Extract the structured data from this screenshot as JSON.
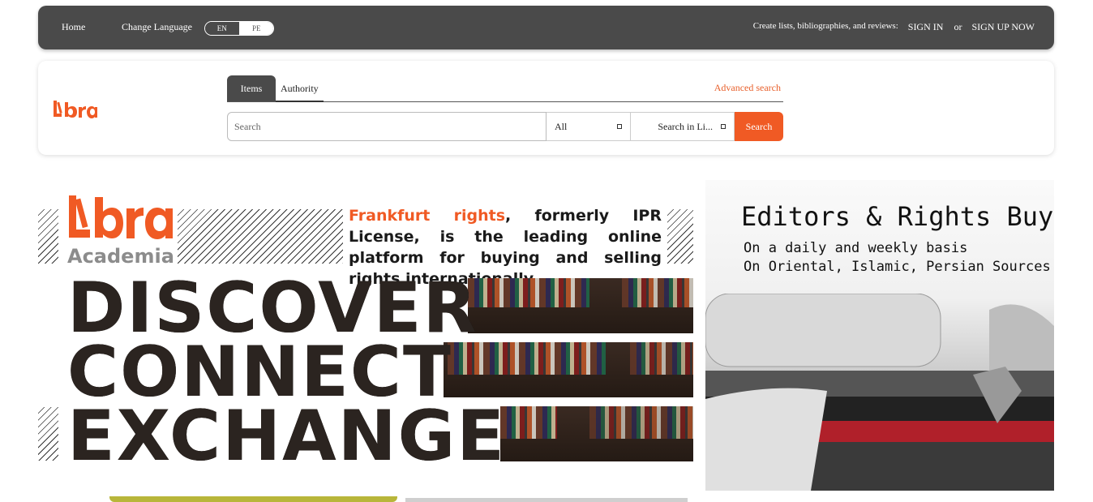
{
  "topbar": {
    "home": "Home",
    "change_language": "Change Language",
    "lang_en": "EN",
    "lang_pe": "PE",
    "cta_text": "Create lists, bibliographies, and reviews:",
    "sign_in": "SIGN IN",
    "or": "or",
    "sign_up": "SIGN UP NOW"
  },
  "search": {
    "tab_items": "Items",
    "tab_authority": "Authority",
    "advanced": "Advanced search",
    "placeholder": "Search",
    "scope_selected": "All",
    "field_selected": "Search in Li...",
    "button": "Search"
  },
  "banner_left": {
    "logo_text": "Libra",
    "academia": "Academia",
    "headline_accent": "Frankfurt rights",
    "headline_rest": ", formerly IPR License, is the leading online platform for buying and selling rights internationally",
    "word1": "DISCOVER",
    "word2": "CONNECT",
    "word3": "EXCHANGE"
  },
  "banner_right": {
    "title": "Editors & Rights Buye",
    "line1": "On a daily and weekly basis",
    "line2": "On Oriental, Islamic, Persian Sources"
  },
  "colors": {
    "accent": "#f05a24",
    "topbar": "#4a4a4a"
  }
}
